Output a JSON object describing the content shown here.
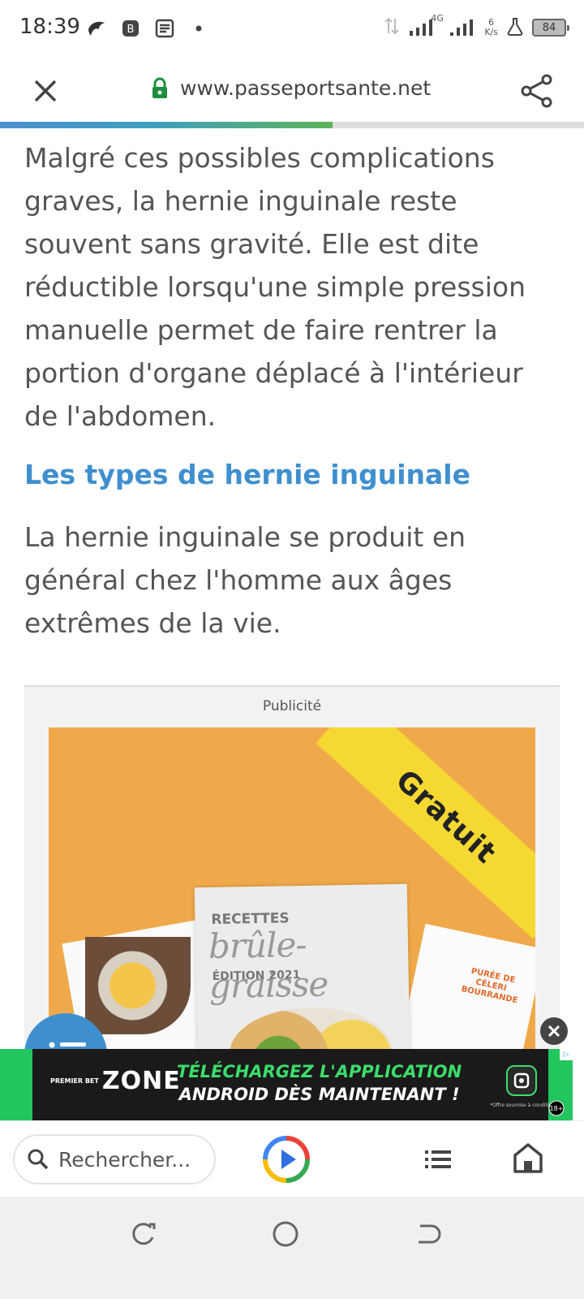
{
  "status_bar": {
    "time": "18:39",
    "network_type": "4G",
    "speed_value": "6",
    "speed_unit": "K/s",
    "battery": "84",
    "icons": [
      "hawk-app-icon",
      "bitcoin-app-icon",
      "news-app-icon",
      "dot-icon",
      "data-arrows-icon",
      "signal-icon",
      "signal-icon-2",
      "flask-icon",
      "battery-icon"
    ]
  },
  "browser": {
    "url": "www.passeportsante.net",
    "load_progress_percent": 57
  },
  "article": {
    "paragraph1": "Malgré ces possibles complications graves, la hernie inguinale reste souvent sans gravité. Elle est dite réductible lorsqu'une simple pression manuelle permet de faire rentrer la portion d'organe déplacé à l'intérieur de l'abdomen.",
    "heading": "Les types de hernie inguinale",
    "paragraph2": "La hernie inguinale se produit en général chez l'homme aux âges extrêmes de la vie."
  },
  "ad": {
    "label": "Publicité",
    "ribbon": "Gratuit",
    "book_line1": "RECETTES",
    "book_line2": "brûle-graisse",
    "book_line3": "ÉDITION 2021",
    "side_card_text": "PURÉE DE CÉLERI BOURRANDE"
  },
  "banner": {
    "brand_small": "PREMIER BET",
    "brand_big": "ZONE",
    "line1": "TÉLÉCHARGEZ L'APPLICATION",
    "line2": "ANDROID DÈS MAINTENANT !",
    "fine_print": "*Offre soumise à conditions",
    "age": "18+"
  },
  "bottom_bar": {
    "search_placeholder": "Rechercher..."
  },
  "colors": {
    "accent": "#3f8fcf",
    "lock": "#1e8e3e",
    "ad_bg": "#efa94a",
    "ribbon": "#f5d832",
    "banner_green": "#22c55e"
  }
}
